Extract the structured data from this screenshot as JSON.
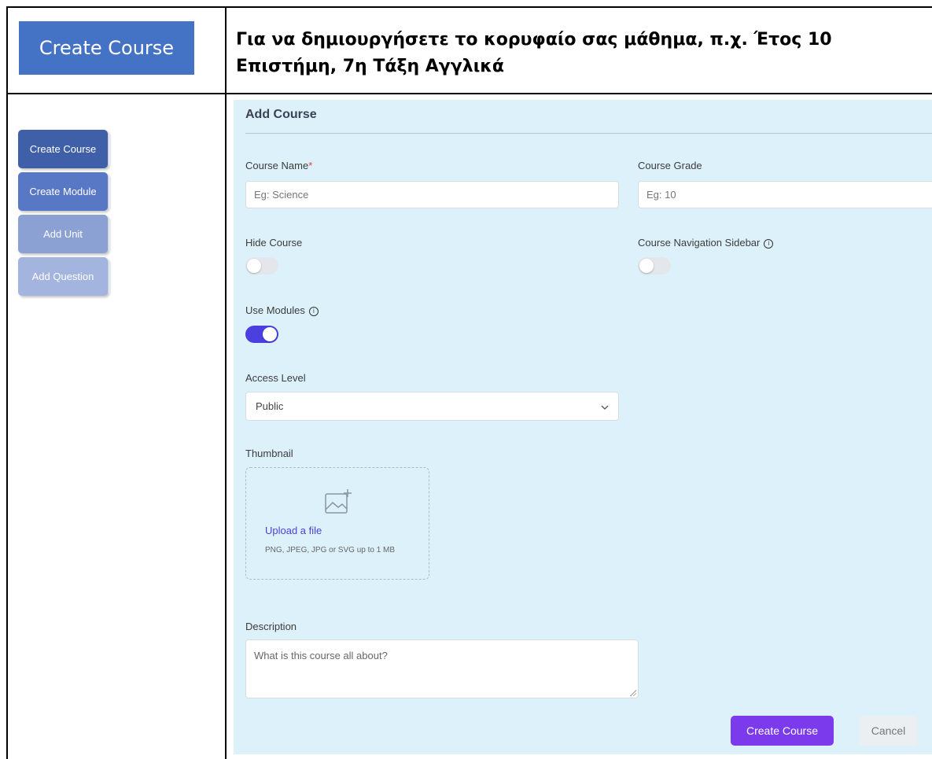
{
  "header": {
    "badge_label": "Create Course",
    "instruction": "Για να δημιουργήσετε το κορυφαίο σας μάθημα, π.χ. Έτος 10 Επιστήμη, 7η Τάξη Αγγλικά"
  },
  "steps": [
    {
      "label": "Create Course",
      "color": "#3f60a8"
    },
    {
      "label": "Create Module",
      "color": "#5878c6"
    },
    {
      "label": "Add Unit",
      "color": "#8ba0d3"
    },
    {
      "label": "Add Question",
      "color": "#a3b4de"
    }
  ],
  "form": {
    "title": "Add Course",
    "course_name": {
      "label": "Course Name",
      "required_mark": "*",
      "placeholder": "Eg: Science"
    },
    "course_grade": {
      "label": "Course Grade",
      "placeholder": "Eg: 10"
    },
    "hide_course": {
      "label": "Hide Course",
      "on": false
    },
    "nav_sidebar": {
      "label": "Course Navigation Sidebar",
      "on": false
    },
    "use_modules": {
      "label": "Use Modules",
      "on": true
    },
    "access_level": {
      "label": "Access Level",
      "value": "Public"
    },
    "thumbnail": {
      "label": "Thumbnail",
      "upload_link": "Upload a file",
      "hint": "PNG, JPEG, JPG or SVG up to 1 MB"
    },
    "description": {
      "label": "Description",
      "placeholder": "What is this course all about?"
    },
    "submit_label": "Create Course",
    "cancel_label": "Cancel"
  },
  "colors": {
    "accent": "#7c3aed",
    "toggle_on": "#4b3fe0",
    "panel_bg": "#ddf1fb",
    "badge_bg": "#4472c4"
  },
  "icons": {
    "info": "info-icon",
    "chevron": "chevron-down-icon",
    "image_add": "image-add-icon"
  }
}
